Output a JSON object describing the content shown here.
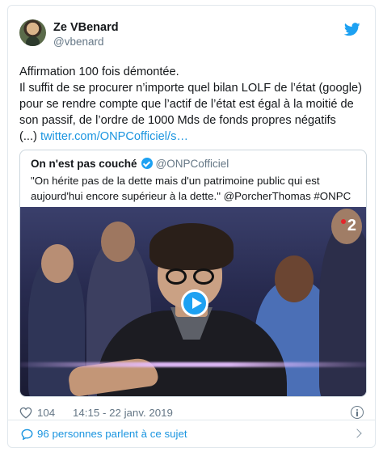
{
  "tweet": {
    "author_name": "Ze VBenard",
    "author_handle": "@vbenard",
    "text": "Affirmation 100 fois démontée.\nIl suffit de se procurer n’importe quel bilan LOLF de l’état (google) pour se rendre compte que l’actif de l’état est égal à la moitié de son passif, de l’ordre de 1000 Mds de fonds propres négatifs\n(...) ",
    "link_text": "twitter.com/ONPCofficiel/s…",
    "likes": "104",
    "timestamp": "14:15 - 22 janv. 2019",
    "conversation_label": "96 personnes parlent à ce sujet"
  },
  "quoted": {
    "author_name": "On n'est pas couché",
    "author_handle": "@ONPCofficiel",
    "text": "\"On hérite pas de la dette mais d'un patrimoine public qui est aujourd'hui encore supérieur à la dette.\" @PorcherThomas #ONPC",
    "channel_logo": "2"
  },
  "colors": {
    "link": "#1b95e0",
    "secondary_text": "#657786",
    "border": "#e1e8ed",
    "twitter_blue": "#1da1f2"
  },
  "icons": [
    "twitter-bird-icon",
    "verified-badge-icon",
    "play-icon",
    "heart-icon",
    "info-icon",
    "speech-bubble-icon",
    "chevron-right-icon"
  ]
}
